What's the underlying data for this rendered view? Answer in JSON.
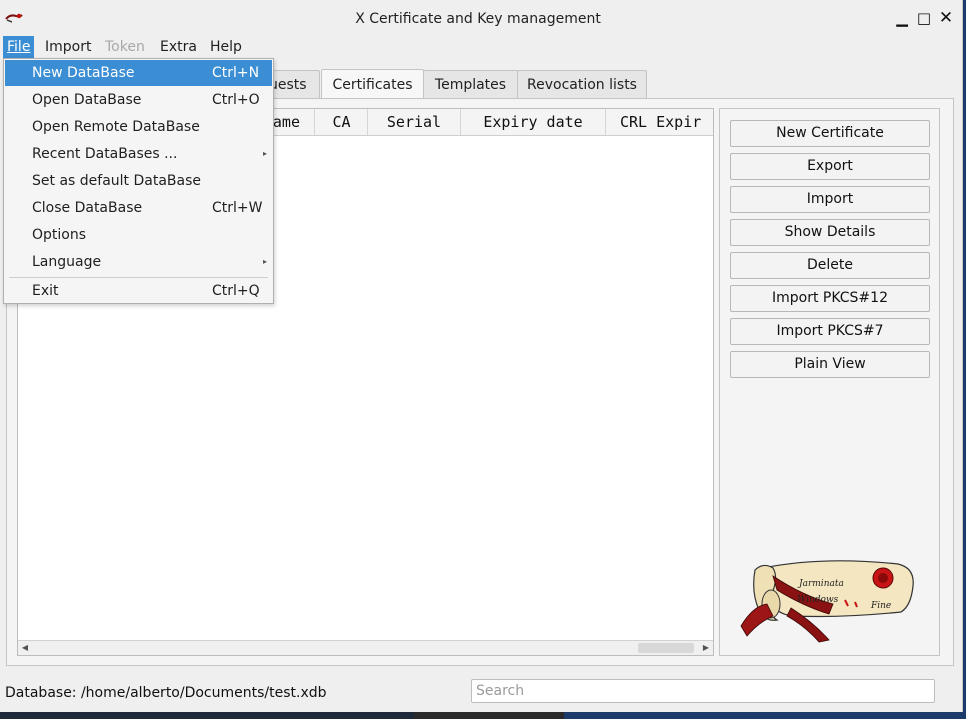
{
  "window": {
    "title": "X Certificate and Key management",
    "controls": {
      "minimize": "▁",
      "maximize": "□",
      "close": "✕"
    }
  },
  "menubar": [
    {
      "label": "File",
      "state": "active"
    },
    {
      "label": "Import",
      "state": "enabled"
    },
    {
      "label": "Token",
      "state": "disabled"
    },
    {
      "label": "Extra",
      "state": "enabled"
    },
    {
      "label": "Help",
      "state": "enabled"
    }
  ],
  "file_menu": [
    {
      "label": "New DataBase",
      "shortcut": "Ctrl+N",
      "highlighted": true
    },
    {
      "label": "Open DataBase",
      "shortcut": "Ctrl+O"
    },
    {
      "label": "Open Remote DataBase",
      "shortcut": ""
    },
    {
      "label": "Recent DataBases ...",
      "shortcut": "",
      "submenu": true
    },
    {
      "label": "Set as default DataBase",
      "shortcut": ""
    },
    {
      "label": "Close DataBase",
      "shortcut": "Ctrl+W"
    },
    {
      "label": "Options",
      "shortcut": ""
    },
    {
      "label": "Language",
      "shortcut": "",
      "submenu": true
    },
    {
      "label": "Exit",
      "shortcut": "Ctrl+Q"
    }
  ],
  "tabs": [
    {
      "label": "uests",
      "selected": false
    },
    {
      "label": "Certificates",
      "selected": true
    },
    {
      "label": "Templates",
      "selected": false
    },
    {
      "label": "Revocation lists",
      "selected": false
    }
  ],
  "table": {
    "columns": [
      "ame",
      "CA",
      "Serial",
      "Expiry date",
      "CRL Expir"
    ]
  },
  "side_buttons": [
    "New Certificate",
    "Export",
    "Import",
    "Show Details",
    "Delete",
    "Import PKCS#12",
    "Import PKCS#7",
    "Plain View"
  ],
  "status": {
    "database_label": "Database: /home/alberto/Documents/test.xdb",
    "search_placeholder": "Search"
  },
  "icons": {
    "app": "scroll-logo-icon",
    "submenu_arrow": "▸",
    "scroll_left": "◀",
    "scroll_right": "▶"
  },
  "colors": {
    "highlight": "#3b8ed3",
    "window_bg": "#efefef",
    "disabled_text": "#a8a8a8"
  }
}
